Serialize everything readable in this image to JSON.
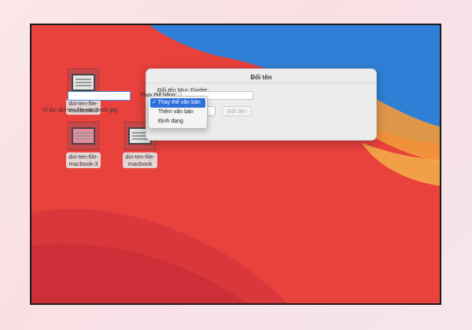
{
  "colors": {
    "wallpaper_red": "#e9413c",
    "wallpaper_blue": "#2f7fd6",
    "accent": "#2f6fdc"
  },
  "desktop": {
    "icons": [
      {
        "label_line1": "doi-ten-file-",
        "label_line2": "macbook-2"
      },
      {
        "label_line1": "doi-ten-file-",
        "label_line2": "macbook-3"
      },
      {
        "label_line1": "doi-ten-file-",
        "label_line2": "macbook"
      }
    ]
  },
  "dialog": {
    "title": "Đổi tên",
    "label": "Đổi tên Mục Finder:",
    "replace_label": "Thay thế bằng:",
    "example": "Ví dụ: doi-ten-file-macbook.jpg",
    "cancel": "Hủy",
    "rename": "Đổi tên"
  },
  "menu": {
    "items": [
      {
        "label": "✓ Thay thế văn bản"
      },
      {
        "label": "Thêm văn bản"
      },
      {
        "label": "Định dạng"
      }
    ]
  }
}
